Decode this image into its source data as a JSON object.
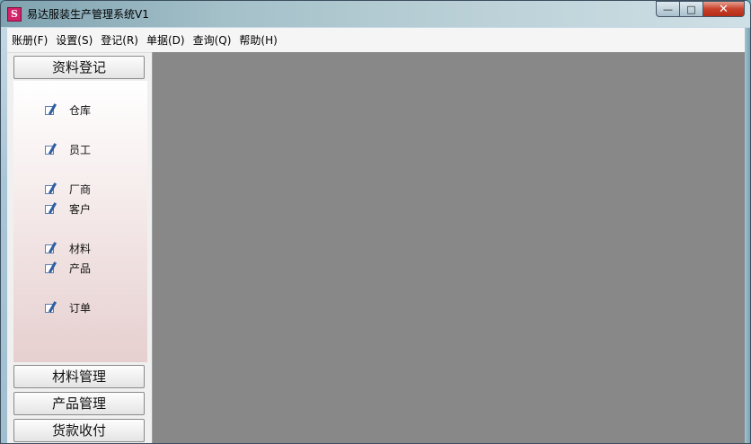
{
  "window": {
    "title": "易达服装生产管理系统V1",
    "app_icon_letter": "S",
    "controls": {
      "minimize": "—",
      "maximize": "□",
      "close": "✕"
    }
  },
  "menubar": [
    "账册(F)",
    "设置(S)",
    "登记(R)",
    "单据(D)",
    "查询(Q)",
    "帮助(H)"
  ],
  "sidebar": {
    "header": "资料登记",
    "items": [
      "仓库",
      "员工",
      "厂商",
      "客户",
      "材料",
      "产品",
      "订单"
    ],
    "footer_buttons": [
      "材料管理",
      "产品管理",
      "货款收付"
    ]
  },
  "colors": {
    "mdi_background": "#888888",
    "close_button": "#c8412b",
    "app_icon": "#d2226a"
  }
}
